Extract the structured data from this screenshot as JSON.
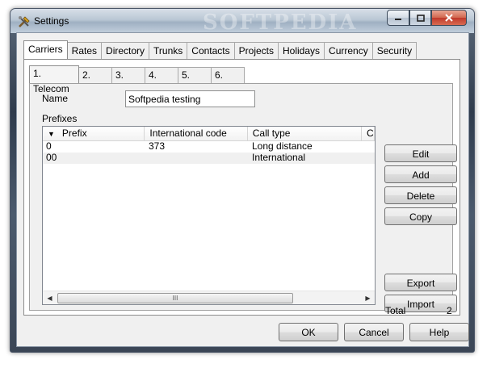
{
  "window": {
    "title": "Settings",
    "watermark": "SOFTPEDIA"
  },
  "tabs": [
    "Carriers",
    "Rates",
    "Directory",
    "Trunks",
    "Contacts",
    "Projects",
    "Holidays",
    "Currency",
    "Security"
  ],
  "carrier_tabs": [
    "1. Telecom",
    "2.",
    "3.",
    "4.",
    "5.",
    "6."
  ],
  "form": {
    "name_label": "Name",
    "name_value": "Softpedia testing",
    "prefixes_label": "Prefixes"
  },
  "table": {
    "columns": [
      "Prefix",
      "International code",
      "Call type",
      "Ca"
    ],
    "rows": [
      [
        "0",
        "373",
        "Long distance",
        ""
      ],
      [
        "00",
        "",
        "International",
        ""
      ]
    ],
    "scroll_thumb_grip": "III"
  },
  "side_buttons": {
    "edit": "Edit",
    "add": "Add",
    "delete": "Delete",
    "copy": "Copy",
    "export": "Export",
    "import": "Import"
  },
  "total": {
    "label": "Total",
    "value": "2"
  },
  "dialog_buttons": {
    "ok": "OK",
    "cancel": "Cancel",
    "help": "Help"
  }
}
